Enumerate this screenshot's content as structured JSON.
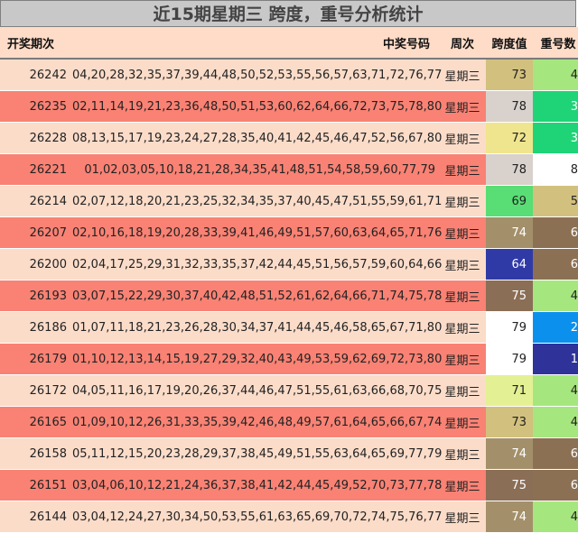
{
  "title": "近15期星期三 跨度，重号分析统计",
  "headers": {
    "period": "开奖期次",
    "numbers": "中奖号码",
    "weekday": "周次",
    "span": "跨度值",
    "repeat": "重号数"
  },
  "rows": [
    {
      "period": "26242",
      "numbers": "04,20,28,32,35,37,39,44,48,50,52,53,55,56,57,63,71,72,76,77",
      "weekday": "星期三",
      "span": "73",
      "repeat": "4",
      "row_color": "#fbdcc9",
      "span_color": "#d2c07e",
      "repeat_color": "#a6e67e"
    },
    {
      "period": "26235",
      "numbers": "02,11,14,19,21,23,36,48,50,51,53,60,62,64,66,72,73,75,78,80",
      "weekday": "星期三",
      "span": "78",
      "repeat": "3",
      "row_color": "#f98274",
      "span_color": "#d8d1cc",
      "repeat_color": "#1ed477"
    },
    {
      "period": "26228",
      "numbers": "08,13,15,17,19,23,24,27,28,35,40,41,42,45,46,47,52,56,67,80",
      "weekday": "星期三",
      "span": "72",
      "repeat": "3",
      "row_color": "#fbdcc9",
      "span_color": "#efe58e",
      "repeat_color": "#1ed477"
    },
    {
      "period": "26221",
      "numbers": "01,02,03,05,10,18,21,28,34,35,41,48,51,54,58,59,60,77,79",
      "weekday": "星期三",
      "span": "78",
      "repeat": "8",
      "row_color": "#f98274",
      "span_color": "#d8d1cc",
      "repeat_color": "#ffffff"
    },
    {
      "period": "26214",
      "numbers": "02,07,12,18,20,21,23,25,32,34,35,37,40,45,47,51,55,59,61,71",
      "weekday": "星期三",
      "span": "69",
      "repeat": "5",
      "row_color": "#fbdcc9",
      "span_color": "#58de74",
      "repeat_color": "#d2c07e"
    },
    {
      "period": "26207",
      "numbers": "02,10,16,18,19,20,28,33,39,41,46,49,51,57,60,63,64,65,71,76",
      "weekday": "星期三",
      "span": "74",
      "repeat": "6",
      "row_color": "#f98274",
      "span_color": "#a3906a",
      "repeat_color": "#8c7054"
    },
    {
      "period": "26200",
      "numbers": "02,04,17,25,29,31,32,33,35,37,42,44,45,51,56,57,59,60,64,66",
      "weekday": "星期三",
      "span": "64",
      "repeat": "6",
      "row_color": "#fbdcc9",
      "span_color": "#303aa6",
      "repeat_color": "#8c7054"
    },
    {
      "period": "26193",
      "numbers": "03,07,15,22,29,30,37,40,42,48,51,52,61,62,64,66,71,74,75,78",
      "weekday": "星期三",
      "span": "75",
      "repeat": "4",
      "row_color": "#f98274",
      "span_color": "#8b6e56",
      "repeat_color": "#a6e67e"
    },
    {
      "period": "26186",
      "numbers": "01,07,11,18,21,23,26,28,30,34,37,41,44,45,46,58,65,67,71,80",
      "weekday": "星期三",
      "span": "79",
      "repeat": "2",
      "row_color": "#fbdcc9",
      "span_color": "#ffffff",
      "repeat_color": "#0b90ee"
    },
    {
      "period": "26179",
      "numbers": "01,10,12,13,14,15,19,27,29,32,40,43,49,53,59,62,69,72,73,80",
      "weekday": "星期三",
      "span": "79",
      "repeat": "1",
      "row_color": "#f98274",
      "span_color": "#ffffff",
      "repeat_color": "#2e3299"
    },
    {
      "period": "26172",
      "numbers": "04,05,11,16,17,19,20,26,37,44,46,47,51,55,61,63,66,68,70,75",
      "weekday": "星期三",
      "span": "71",
      "repeat": "4",
      "row_color": "#fbdcc9",
      "span_color": "#e4f094",
      "repeat_color": "#a6e67e"
    },
    {
      "period": "26165",
      "numbers": "01,09,10,12,26,31,33,35,39,42,46,48,49,57,61,64,65,66,67,74",
      "weekday": "星期三",
      "span": "73",
      "repeat": "4",
      "row_color": "#f98274",
      "span_color": "#d2c07e",
      "repeat_color": "#a6e67e"
    },
    {
      "period": "26158",
      "numbers": "05,11,12,15,20,23,28,29,37,38,45,49,51,55,63,64,65,69,77,79",
      "weekday": "星期三",
      "span": "74",
      "repeat": "6",
      "row_color": "#fbdcc9",
      "span_color": "#a3906a",
      "repeat_color": "#8c7054"
    },
    {
      "period": "26151",
      "numbers": "03,04,06,10,12,21,24,36,37,38,41,42,44,45,49,52,70,73,77,78",
      "weekday": "星期三",
      "span": "75",
      "repeat": "6",
      "row_color": "#f98274",
      "span_color": "#8b6e56",
      "repeat_color": "#8c7054"
    },
    {
      "period": "26144",
      "numbers": "03,04,12,24,27,30,34,50,53,55,61,63,65,69,70,72,74,75,76,77",
      "weekday": "星期三",
      "span": "74",
      "repeat": "4",
      "row_color": "#fbdcc9",
      "span_color": "#a3906a",
      "repeat_color": "#a6e67e"
    }
  ]
}
